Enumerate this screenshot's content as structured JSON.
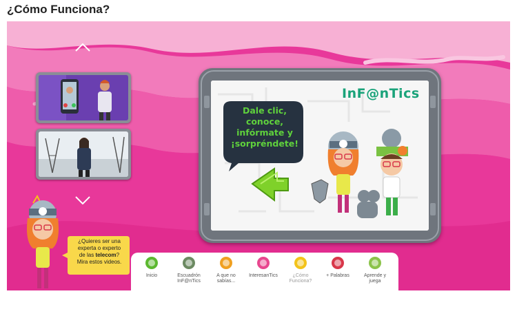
{
  "page": {
    "title": "¿Cómo Funciona?"
  },
  "logo": {
    "text": "InF@nTics"
  },
  "bubble": {
    "line1": "Dale clic, conoce,",
    "line2": "infórmate y",
    "line3": "¡sorpréndete!"
  },
  "promo": {
    "line1": "¿Quieres ser una",
    "line2": "experta o experto",
    "line3_pre": "de las ",
    "line3_bold": "telecom",
    "line3_post": "?",
    "line4": "Mira estos videos."
  },
  "nav": {
    "items": [
      {
        "line1": "Inicio",
        "line2": "",
        "color": "#5cb830"
      },
      {
        "line1": "Escuadrón",
        "line2": "InF@nTics",
        "color": "#6c8a62"
      },
      {
        "line1": "A que no",
        "line2": "sabías...",
        "color": "#f0a020"
      },
      {
        "line1": "InteresanTics",
        "line2": "",
        "color": "#e8478f"
      },
      {
        "line1": "¿Cómo",
        "line2": "Funciona?",
        "color": "#f3c31a"
      },
      {
        "line1": "+ Palabras",
        "line2": "",
        "color": "#d8374a"
      },
      {
        "line1": "Aprende y",
        "line2": "juega",
        "color": "#8bc34a"
      }
    ]
  },
  "colors": {
    "stage_pink": "#e8389a",
    "monitor_frame": "#6f757d",
    "bubble_dark": "#263240",
    "bubble_text": "#5fd13c",
    "arrow_green": "#7fd12a"
  },
  "icons": {
    "scroll_up": "chevron-up-icon",
    "scroll_down": "chevron-down-icon",
    "back": "green-back-arrow-icon"
  }
}
